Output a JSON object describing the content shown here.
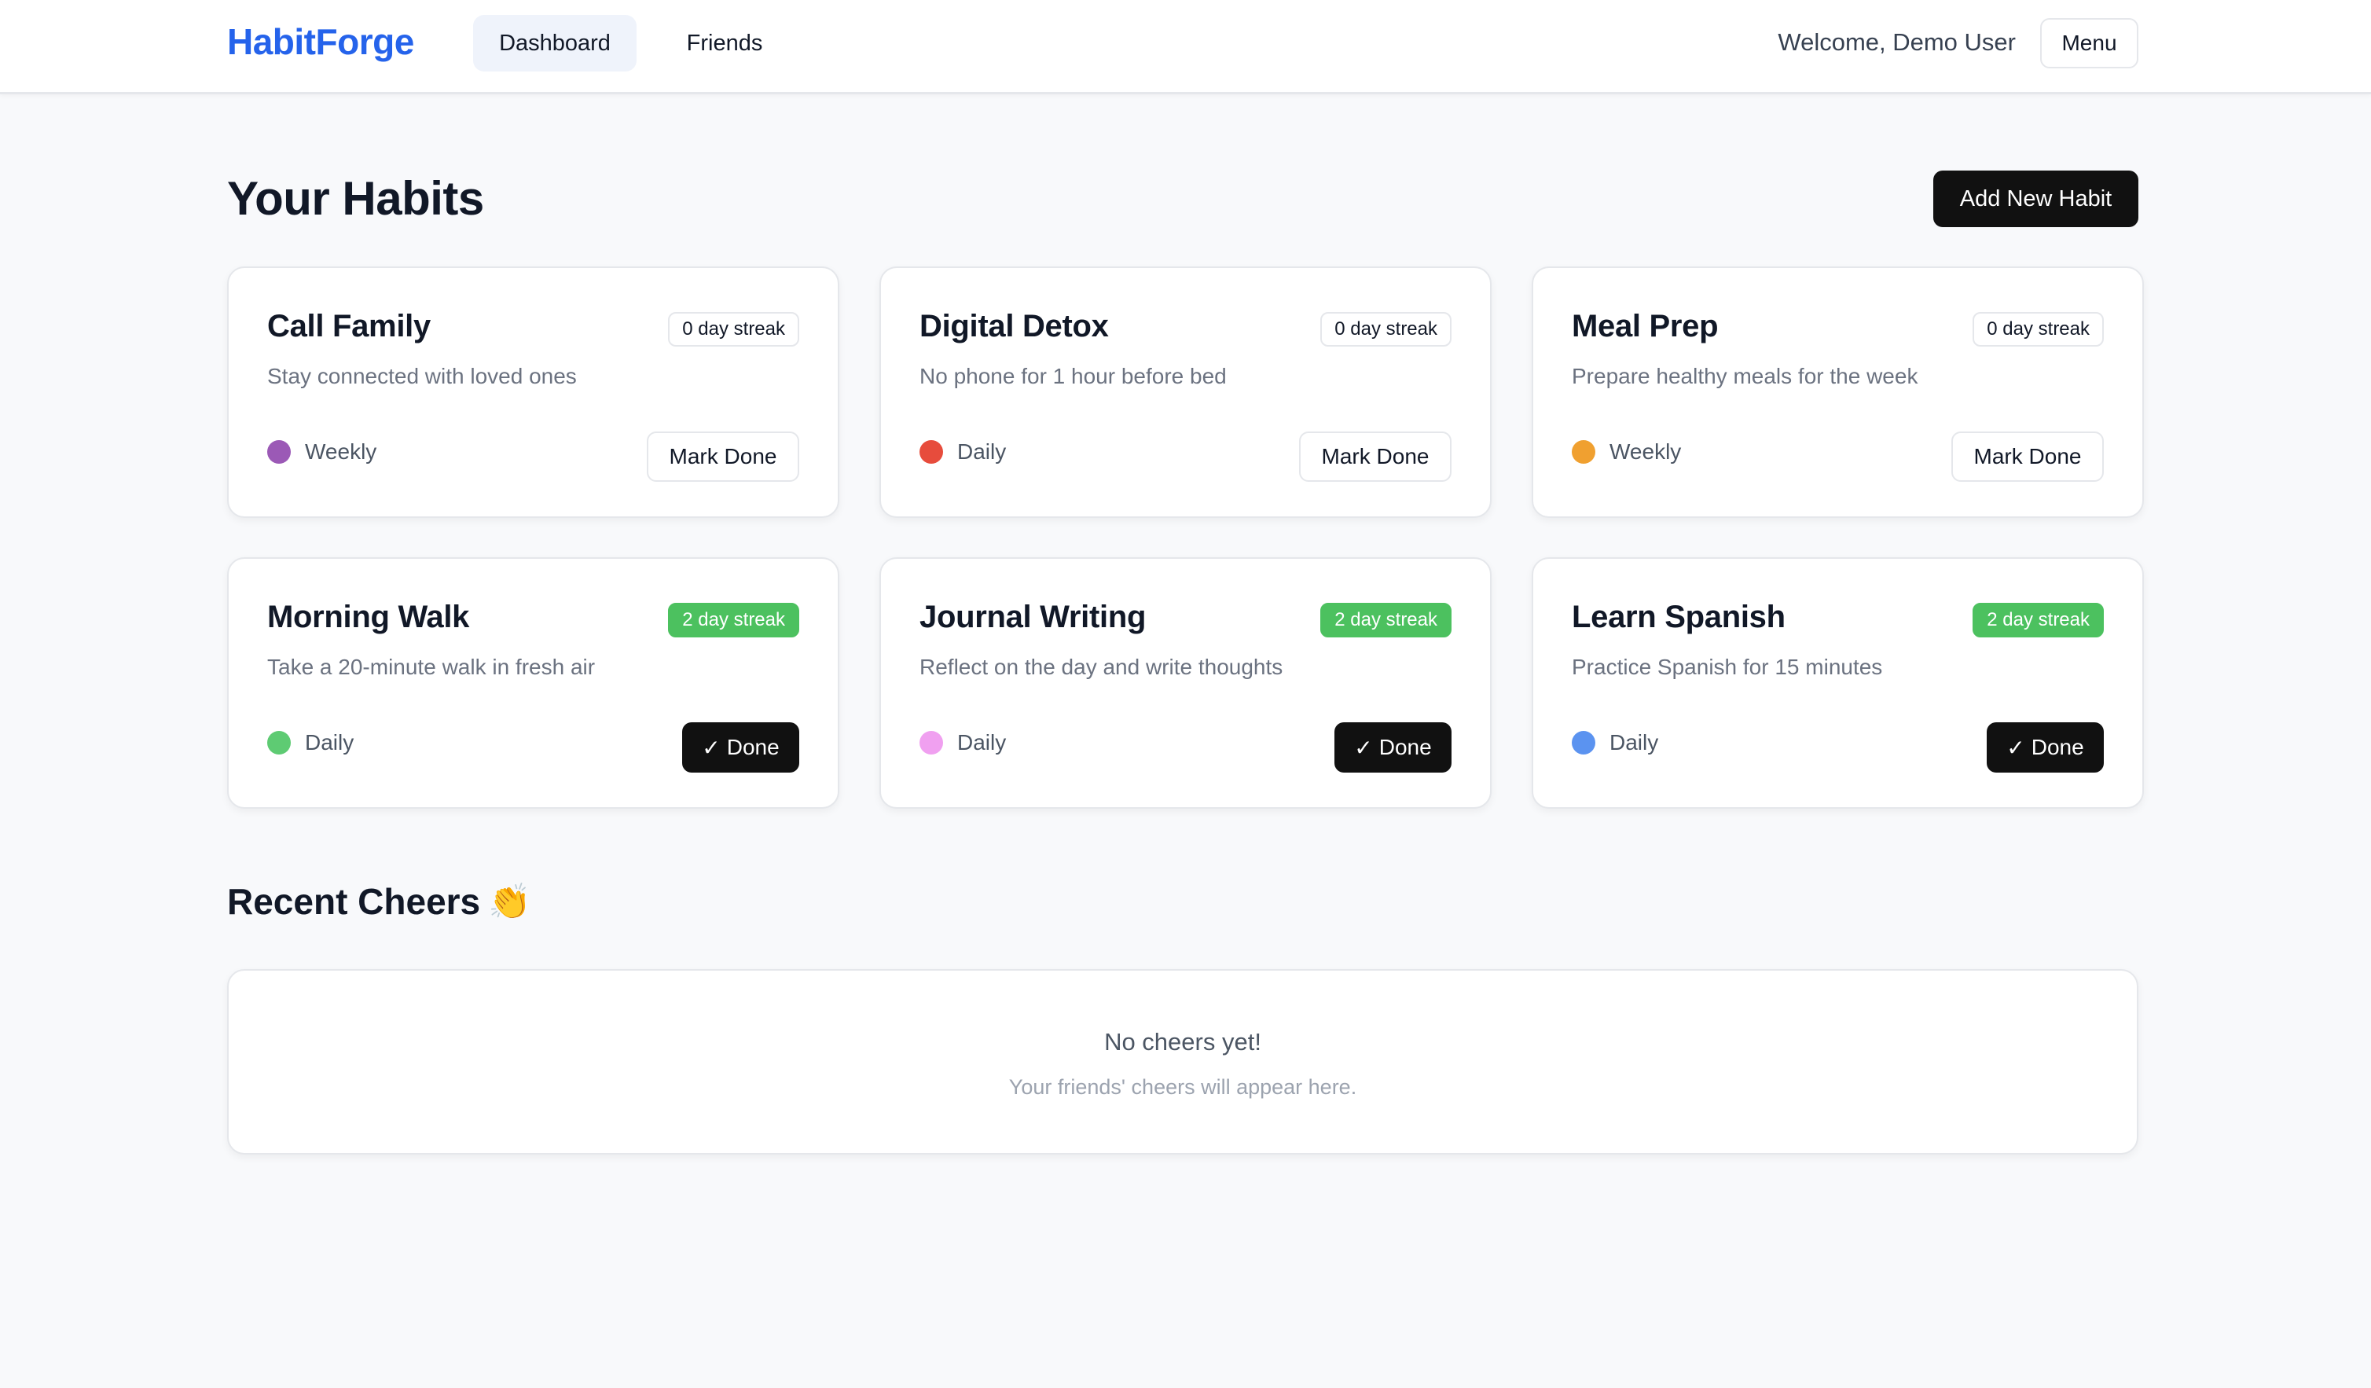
{
  "header": {
    "brand": "HabitForge",
    "nav": [
      {
        "label": "Dashboard",
        "active": true
      },
      {
        "label": "Friends",
        "active": false
      }
    ],
    "welcome": "Welcome, Demo User",
    "menu_label": "Menu"
  },
  "main": {
    "title": "Your Habits",
    "add_button": "Add New Habit",
    "habits": [
      {
        "title": "Call Family",
        "description": "Stay connected with loved ones",
        "streak": "0 day streak",
        "frequency": "Weekly",
        "color": "#9b59b6",
        "action": "Mark Done",
        "completed": false
      },
      {
        "title": "Digital Detox",
        "description": "No phone for 1 hour before bed",
        "streak": "0 day streak",
        "frequency": "Daily",
        "color": "#e74c3c",
        "action": "Mark Done",
        "completed": false
      },
      {
        "title": "Meal Prep",
        "description": "Prepare healthy meals for the week",
        "streak": "0 day streak",
        "frequency": "Weekly",
        "color": "#f0a030",
        "action": "Mark Done",
        "completed": false
      },
      {
        "title": "Morning Walk",
        "description": "Take a 20-minute walk in fresh air",
        "streak": "2 day streak",
        "frequency": "Daily",
        "color": "#5ecb73",
        "action": "Done",
        "completed": true
      },
      {
        "title": "Journal Writing",
        "description": "Reflect on the day and write thoughts",
        "streak": "2 day streak",
        "frequency": "Daily",
        "color": "#f0a0f0",
        "action": "Done",
        "completed": true
      },
      {
        "title": "Learn Spanish",
        "description": "Practice Spanish for 15 minutes",
        "streak": "2 day streak",
        "frequency": "Daily",
        "color": "#5b93f0",
        "action": "Done",
        "completed": true
      }
    ]
  },
  "cheers": {
    "title": "Recent Cheers",
    "icon": "clapping-hands-icon",
    "empty_title": "No cheers yet!",
    "empty_subtitle": "Your friends' cheers will appear here."
  },
  "colors": {
    "brand": "#2563eb",
    "streak_active": "#4cc15f",
    "primary_button": "#111111"
  }
}
